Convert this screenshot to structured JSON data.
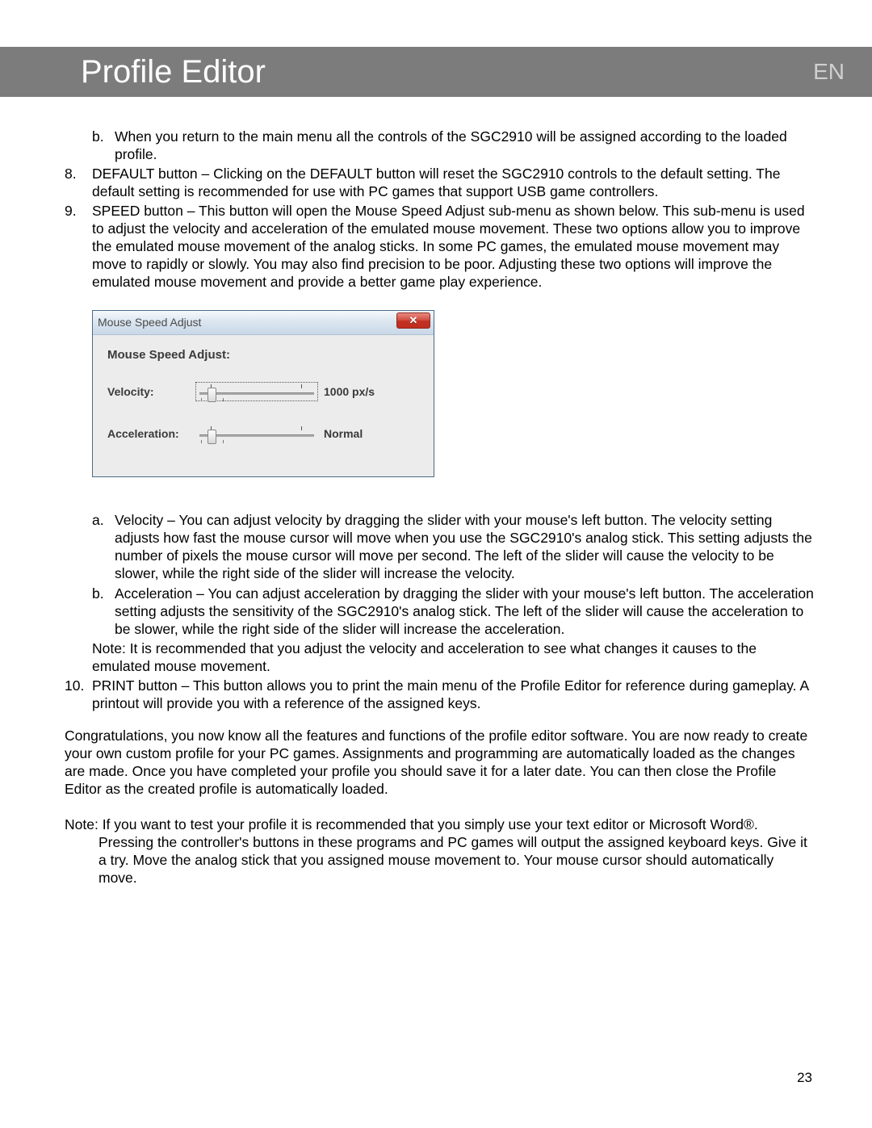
{
  "header": {
    "title": "Profile Editor",
    "lang": "EN"
  },
  "items": {
    "b_return": "When you return to the main menu all the controls of the SGC2910 will be assigned according to the loaded profile.",
    "n8": "DEFAULT button – Clicking on the DEFAULT button will reset the SGC2910 controls to the default setting. The default setting is recommended for use with PC games that support USB game controllers.",
    "n9": "SPEED button – This button will open the Mouse Speed Adjust sub-menu as shown below. This sub-menu is used to adjust the velocity and acceleration of the emulated mouse movement. These two options allow you to improve the emulated mouse movement of the analog sticks. In some PC games, the emulated mouse movement may move to rapidly or slowly. You may also find precision to be poor. Adjusting these two options will improve the emulated mouse movement and provide a better game play experience.",
    "sub_a": "Velocity – You can adjust velocity by dragging the slider with your mouse's left button. The velocity setting adjusts how fast the mouse cursor will move when you use the SGC2910's analog stick. This setting adjusts the number of pixels the mouse cursor will move per second. The left of the slider will cause the velocity to be slower, while the right side of the slider will increase the velocity.",
    "sub_b": "Acceleration – You can adjust acceleration by dragging the slider with your mouse's left button. The acceleration setting adjusts the sensitivity of the SGC2910's analog stick. The left of the slider will cause the acceleration to be slower, while the right side of the slider will increase the acceleration.",
    "note9": "Note: It is recommended that you adjust the velocity and acceleration to see what changes it causes to the emulated mouse movement.",
    "n10": "PRINT button – This button allows you to print the main menu of the Profile Editor for reference during gameplay. A printout will provide you with a reference of the assigned keys."
  },
  "dialog": {
    "title": "Mouse Speed Adjust",
    "heading": "Mouse Speed Adjust:",
    "velocity_label": "Velocity:",
    "velocity_value": "1000 px/s",
    "accel_label": "Acceleration:",
    "accel_value": "Normal"
  },
  "closing": "Congratulations, you now know all the features and functions of the profile editor software. You are now ready to create your own custom profile for your PC games. Assignments and programming are automatically loaded as the changes are made. Once you have completed your profile you should save it for a later date. You can then close the Profile Editor as the created profile is automatically loaded.",
  "final_note": "Note: If you want to test your profile it is recommended that you simply use your text editor or Microsoft Word®. Pressing the controller's buttons in these programs and PC games will output the assigned keyboard keys. Give it a try. Move the analog stick that you assigned mouse movement to. Your mouse cursor should automatically move.",
  "page_number": "23"
}
